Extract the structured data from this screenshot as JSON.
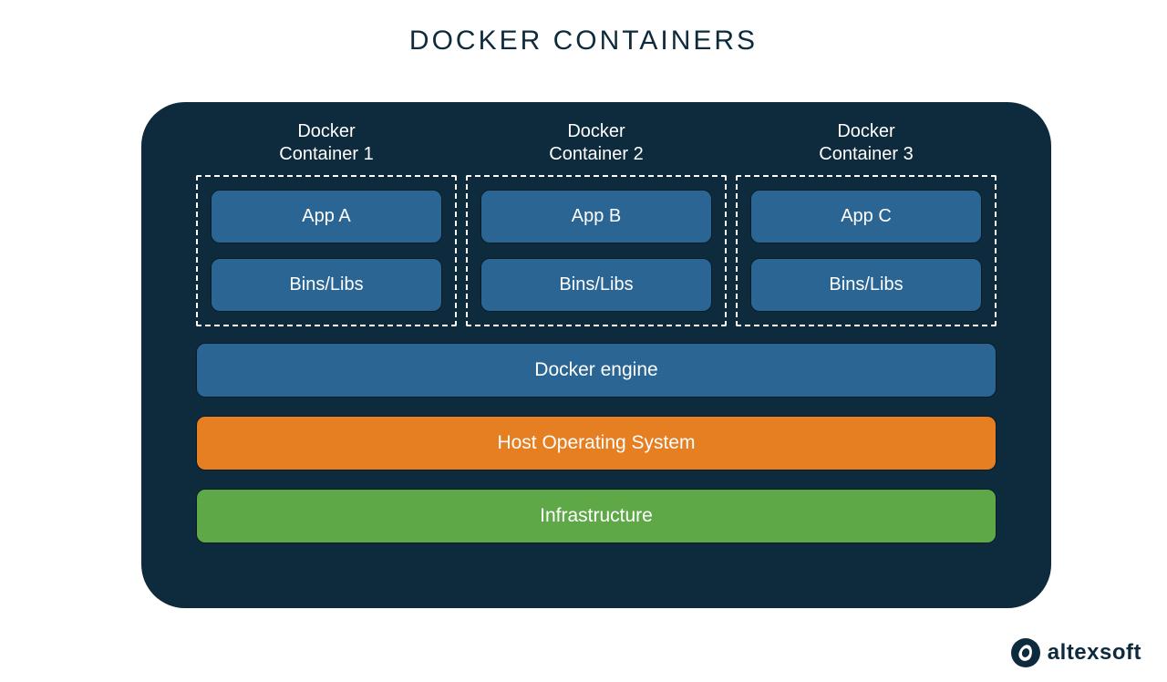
{
  "title": "DOCKER CONTAINERS",
  "containers": [
    {
      "label": "Docker\nContainer 1",
      "app": "App A",
      "bins": "Bins/Libs"
    },
    {
      "label": "Docker\nContainer 2",
      "app": "App B",
      "bins": "Bins/Libs"
    },
    {
      "label": "Docker\nContainer 3",
      "app": "App C",
      "bins": "Bins/Libs"
    }
  ],
  "layers": {
    "engine": "Docker engine",
    "os": "Host Operating System",
    "infra": "Infrastructure"
  },
  "brand": "altexsoft",
  "colors": {
    "panel": "#0e2a3d",
    "blue": "#2a6593",
    "orange": "#e67e22",
    "green": "#5ea847"
  }
}
